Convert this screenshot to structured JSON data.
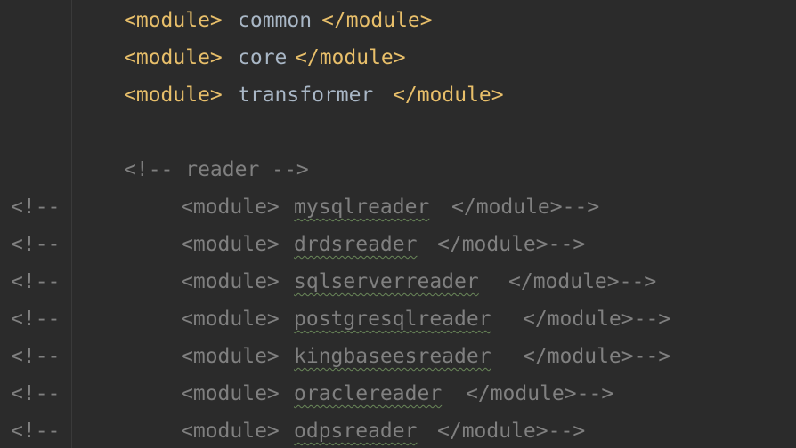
{
  "editor": {
    "active_lines": [
      {
        "open": "<module>",
        "name": "common",
        "close": "</module>"
      },
      {
        "open": "<module>",
        "name": "core",
        "close": "</module>"
      },
      {
        "open": "<module>",
        "name": "transformer",
        "close": "</module>"
      }
    ],
    "section_comment": "<!-- reader -->",
    "commented_lines": [
      {
        "gutter": "<!--",
        "open": "<module>",
        "name": "mysqlreader",
        "close": "</module>-->"
      },
      {
        "gutter": "<!--",
        "open": "<module>",
        "name": "drdsreader",
        "close": "</module>-->"
      },
      {
        "gutter": "<!--",
        "open": "<module>",
        "name": "sqlserverreader",
        "close": "</module>-->"
      },
      {
        "gutter": "<!--",
        "open": "<module>",
        "name": "postgresqlreader",
        "close": "</module>-->"
      },
      {
        "gutter": "<!--",
        "open": "<module>",
        "name": "kingbaseesreader",
        "close": "</module>-->"
      },
      {
        "gutter": "<!--",
        "open": "<module>",
        "name": "oraclereader",
        "close": "</module>-->"
      },
      {
        "gutter": "<!--",
        "open": "<module>",
        "name": "odpsreader",
        "close": "</module>-->"
      }
    ]
  },
  "colors": {
    "background": "#2b2b2b",
    "tag": "#e8bf6a",
    "text": "#a9b7c6",
    "comment": "#808080",
    "spellcheck_underline": "#6a8759"
  }
}
